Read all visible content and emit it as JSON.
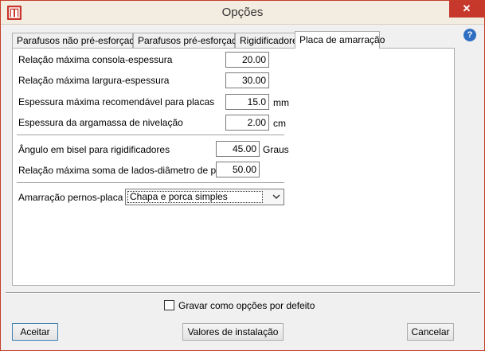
{
  "window": {
    "title": "Opções",
    "close_glyph": "✕",
    "help_glyph": "?",
    "accent_color": "#c7382c"
  },
  "tabs": [
    {
      "label": "Parafusos não pré-esforçados",
      "active": false
    },
    {
      "label": "Parafusos pré-esforçados",
      "active": false
    },
    {
      "label": "Rigidificadores",
      "active": false
    },
    {
      "label": "Placa de amarração",
      "active": true
    }
  ],
  "fields": [
    {
      "label": "Relação máxima consola-espessura",
      "value": "20.00",
      "unit": ""
    },
    {
      "label": "Relação máxima largura-espessura",
      "value": "30.00",
      "unit": ""
    },
    {
      "label": "Espessura máxima recomendável para placas",
      "value": "15.0",
      "unit": "mm"
    },
    {
      "label": "Espessura da argamassa de nivelação",
      "value": "2.00",
      "unit": "cm"
    },
    {
      "label": "Ângulo em bisel para rigidificadores",
      "value": "45.00",
      "unit": "Graus"
    },
    {
      "label": "Relação máxima soma de lados-diâmetro de pernos",
      "value": "50.00",
      "unit": ""
    }
  ],
  "select": {
    "label": "Amarração pernos-placa",
    "value": "Chapa e porca simples"
  },
  "checkbox": {
    "label": "Gravar como opções por defeito",
    "checked": false
  },
  "buttons": {
    "accept": "Aceitar",
    "install_values": "Valores de instalação",
    "cancel": "Cancelar"
  }
}
